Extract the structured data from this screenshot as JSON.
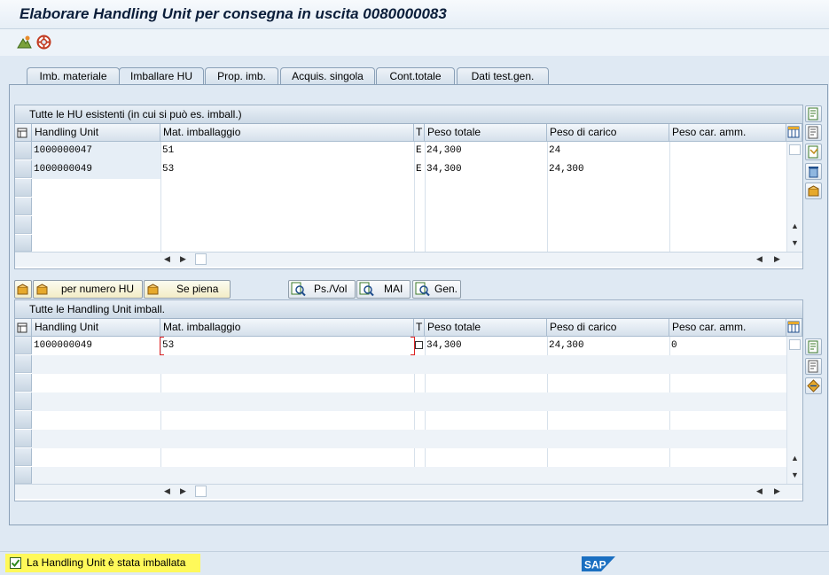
{
  "window": {
    "title": "Elaborare Handling Unit per consegna in uscita 0080000083"
  },
  "tabs": [
    {
      "label": "Imb. materiale"
    },
    {
      "label": "Imballare HU"
    },
    {
      "label": "Prop. imb."
    },
    {
      "label": "Acquis. singola"
    },
    {
      "label": "Cont.totale"
    },
    {
      "label": "Dati test.gen."
    }
  ],
  "grid_top": {
    "title": "Tutte le HU esistenti (in cui si può es. imball.)",
    "columns": [
      "Handling Unit",
      "Mat. imballaggio",
      "T",
      "Peso totale",
      "Peso di carico",
      "Peso car. amm."
    ],
    "rows": [
      {
        "hu": "1000000047",
        "mat": "51",
        "t": "E",
        "peso_tot": "24,300",
        "peso_car": "24",
        "peso_amm": ""
      },
      {
        "hu": "1000000049",
        "mat": "53",
        "t": "E",
        "peso_tot": "34,300",
        "peso_car": "24,300",
        "peso_amm": ""
      }
    ]
  },
  "buttons": {
    "per_numero_hu": "per numero HU",
    "se_piena": "Se piena",
    "ps_vol": "Ps./Vol",
    "mai": "MAI",
    "gen": "Gen."
  },
  "grid_bottom": {
    "title": "Tutte le Handling Unit imball.",
    "columns": [
      "Handling Unit",
      "Mat. imballaggio",
      "T",
      "Peso totale",
      "Peso di carico",
      "Peso car. amm."
    ],
    "rows": [
      {
        "hu": "1000000049",
        "mat": "53",
        "t": "",
        "peso_tot": "34,300",
        "peso_car": "24,300",
        "peso_amm": "0"
      }
    ]
  },
  "status": {
    "message": "La Handling Unit è stata imballata"
  },
  "brand": {
    "logo": "SAP",
    "color": "#1a6fc1"
  },
  "colors": {
    "status_highlight": "#fff95a",
    "title_text": "#0b1e3a"
  }
}
